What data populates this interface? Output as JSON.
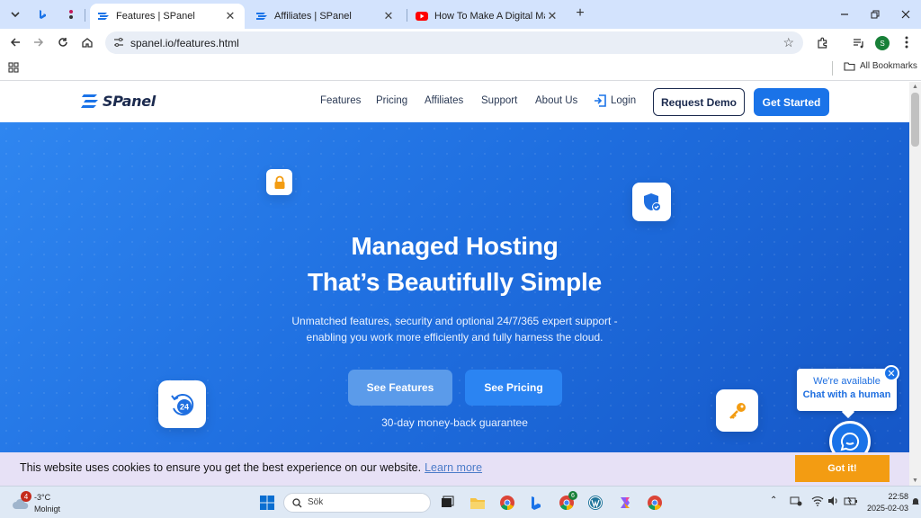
{
  "browser": {
    "tabs": [
      {
        "title": "Features | SPanel",
        "active": true
      },
      {
        "title": "Affiliates | SPanel",
        "active": false
      },
      {
        "title": "How To Make A Digital Marketi",
        "active": false
      }
    ],
    "url": "spanel.io/features.html",
    "profile_initial": "S",
    "all_bookmarks": "All Bookmarks"
  },
  "site": {
    "logo_text": "SPanel",
    "nav": [
      "Features",
      "Pricing",
      "Affiliates",
      "Support",
      "About Us"
    ],
    "login": "Login",
    "request_demo": "Request Demo",
    "get_started": "Get Started"
  },
  "hero": {
    "title_line1": "Managed Hosting",
    "title_line2": "That’s Beautifully Simple",
    "subtitle_line1": "Unmatched features, security and optional 24/7/365 expert support -",
    "subtitle_line2": "enabling you work more efficiently and fully harness the cloud.",
    "btn_features": "See Features",
    "btn_pricing": "See Pricing",
    "guarantee": "30-day money-back guarantee",
    "badge_24": "24"
  },
  "chat": {
    "line1": "We're available",
    "line2": "Chat with a human"
  },
  "cookie": {
    "message": "This website uses cookies to ensure you get the best experience on our website.",
    "learn_more": "Learn more",
    "got_it": "Got it!"
  },
  "taskbar": {
    "weather_temp": "-3°C",
    "weather_cond": "Molnigt",
    "weather_badge": "4",
    "search_label": "Sök",
    "chrome_badge": "6",
    "time": "22:58",
    "date": "2025-02-03"
  },
  "colors": {
    "brand_blue": "#1a73e8",
    "hero_gradient_start": "#2f86f0",
    "hero_gradient_end": "#1556c6",
    "cookie_button": "#f39c12"
  }
}
